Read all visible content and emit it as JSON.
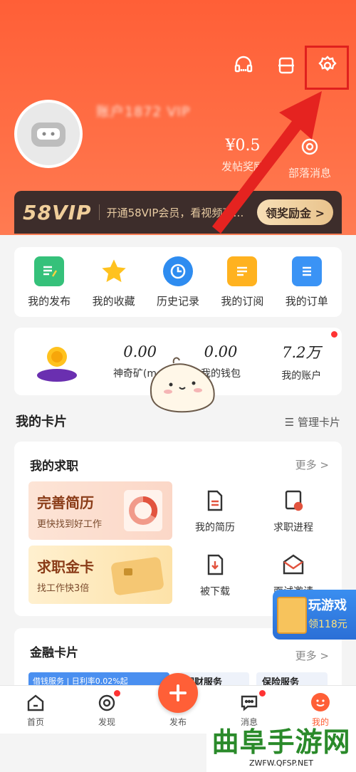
{
  "header": {
    "username": "账户1872 VIP",
    "stats": [
      {
        "value": "",
        "label": ""
      },
      {
        "value": "",
        "label": ""
      },
      {
        "value": "¥0.5",
        "label": "发帖奖励"
      },
      {
        "value": "",
        "label": "部落消息"
      }
    ],
    "vip": {
      "logo": "58VIP",
      "text": "开通58VIP会员，看视频享…",
      "button": "领奖励金 >"
    }
  },
  "quick_actions": [
    {
      "label": "我的发布",
      "icon": "publish-icon",
      "color": "#35c17a"
    },
    {
      "label": "我的收藏",
      "icon": "star-icon",
      "color": "#ffc21f"
    },
    {
      "label": "历史记录",
      "icon": "clock-icon",
      "color": "#2e8cf0"
    },
    {
      "label": "我的订阅",
      "icon": "subscribe-icon",
      "color": "#ffb21f"
    },
    {
      "label": "我的订单",
      "icon": "order-icon",
      "color": "#3a93f5"
    }
  ],
  "wallet": [
    {
      "value": "0.00",
      "label": "神奇矿(mg)"
    },
    {
      "value": "0.00",
      "label": "我的钱包"
    },
    {
      "value": "7.2万",
      "label": "我的账户"
    }
  ],
  "cards_section": {
    "title": "我的卡片",
    "manage": "管理卡片"
  },
  "job_card": {
    "title": "我的求职",
    "more": "更多 >",
    "promos": [
      {
        "title": "完善简历",
        "subtitle": "更快找到好工作"
      },
      {
        "title": "求职金卡",
        "subtitle": "找工作快3倍"
      }
    ],
    "items": [
      "我的简历",
      "求职进程",
      "被下载",
      "面试邀请"
    ]
  },
  "finance_card": {
    "title": "金融卡片",
    "more": "更多 >",
    "tags": [
      "借钱服务 | 日利率0.02%起",
      "理财服务",
      "保险服务"
    ]
  },
  "game_badge": {
    "title": "玩游戏",
    "subtitle": "领118元"
  },
  "nav": [
    {
      "label": "首页",
      "icon": "home-icon"
    },
    {
      "label": "发现",
      "icon": "discover-icon"
    },
    {
      "label": "发布",
      "icon": "plus-icon"
    },
    {
      "label": "消息",
      "icon": "message-icon"
    },
    {
      "label": "我的",
      "icon": "me-icon"
    }
  ],
  "watermark": {
    "title": "曲阜手游网",
    "url": "ZWFW.QFSP.NET"
  }
}
